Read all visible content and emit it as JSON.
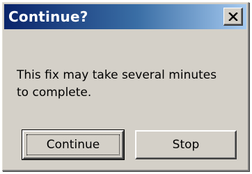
{
  "dialog": {
    "title": "Continue?",
    "close_icon": "close-x-icon",
    "message_line1": "This fix may take several minutes",
    "message_line2": "to complete.",
    "buttons": {
      "continue_label": "Continue",
      "stop_label": "Stop"
    },
    "colors": {
      "titlebar_start": "#0a246a",
      "titlebar_end": "#a6caf0",
      "face": "#d4d0c8"
    }
  }
}
